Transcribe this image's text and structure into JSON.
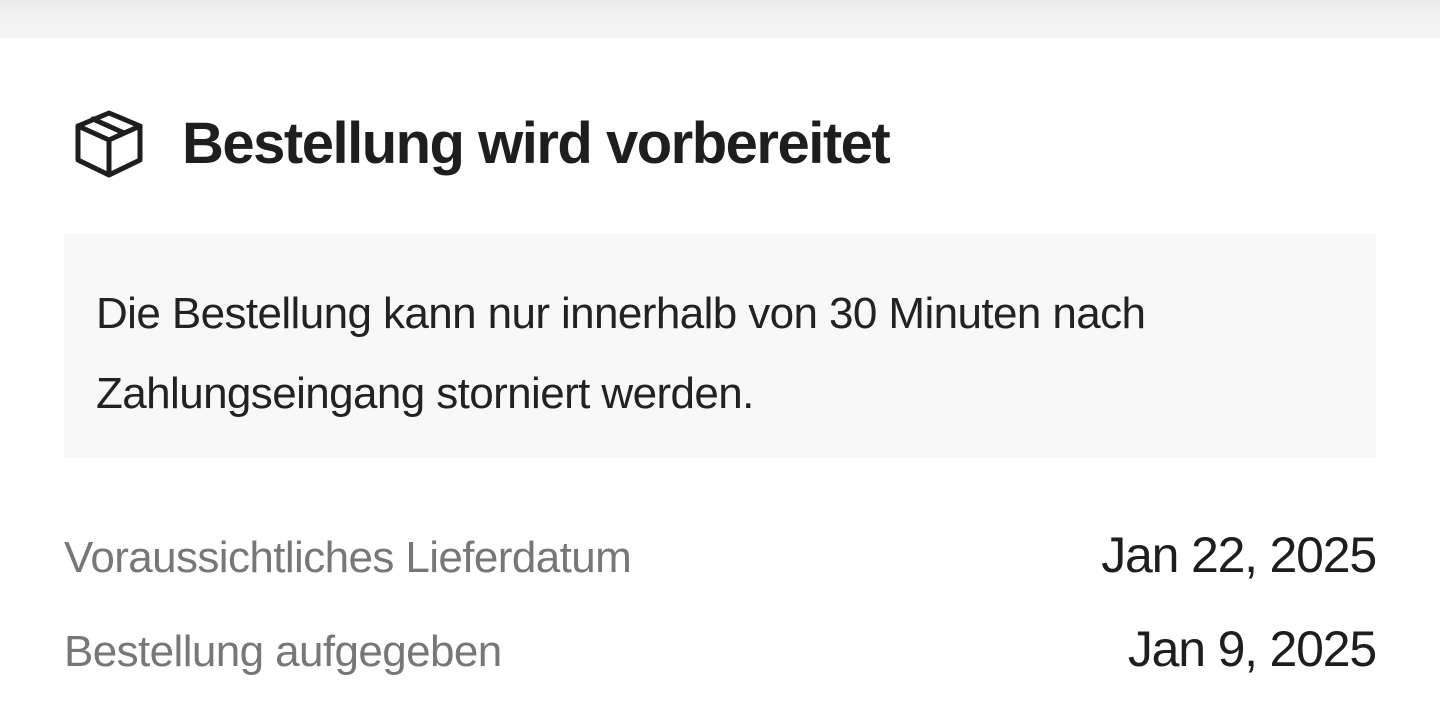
{
  "header": {
    "icon": "package-box-icon",
    "title": "Bestellung wird vorbereitet"
  },
  "notice": {
    "text": "Die Bestellung kann nur innerhalb von 30 Minuten nach Zahlungseingang storniert werden."
  },
  "details": [
    {
      "label": "Voraussichtliches Lieferdatum",
      "value": "Jan 22, 2025"
    },
    {
      "label": "Bestellung aufgegeben",
      "value": "Jan 9, 2025"
    }
  ],
  "colors": {
    "top_bar": "#f2f2f2",
    "notice_background": "#f8f8f8",
    "label_text": "#777777",
    "value_text": "#1e1e1e"
  }
}
